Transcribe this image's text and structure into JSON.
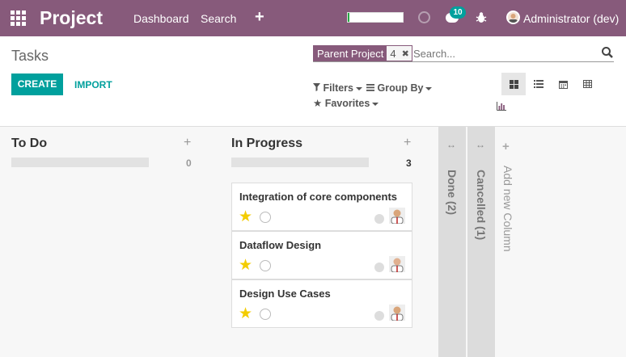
{
  "navbar": {
    "brand": "Project",
    "links": [
      "Dashboard",
      "Search"
    ],
    "plus_icon": "plus-icon",
    "progress_value": 0.03,
    "progress_color": "#28a745",
    "chat_count": "10",
    "user_name": "Administrator (dev)",
    "bg_color": "#875a7b"
  },
  "control_panel": {
    "title": "Tasks",
    "search": {
      "facet_label": "Parent Project",
      "facet_value": "4",
      "placeholder": "Search..."
    },
    "buttons": {
      "create": "CREATE",
      "import": "IMPORT"
    },
    "filters": {
      "filters": "Filters",
      "group_by": "Group By",
      "favorites": "Favorites"
    },
    "views": [
      "kanban-view-icon",
      "list-view-icon",
      "calendar-view-icon",
      "pivot-view-icon",
      "graph-view-icon"
    ],
    "active_view": "kanban",
    "accent_color": "#00a09d"
  },
  "kanban": {
    "columns": [
      {
        "title": "To Do",
        "count": "0",
        "cards": []
      },
      {
        "title": "In Progress",
        "count": "3",
        "cards": [
          {
            "title": "Integration of core components",
            "starred": true
          },
          {
            "title": "Dataflow Design",
            "starred": true
          },
          {
            "title": "Design Use Cases",
            "starred": true
          }
        ]
      }
    ],
    "folded": [
      {
        "title": "Done (2)"
      },
      {
        "title": "Cancelled (1)"
      }
    ],
    "add_column": "Add new Column"
  }
}
